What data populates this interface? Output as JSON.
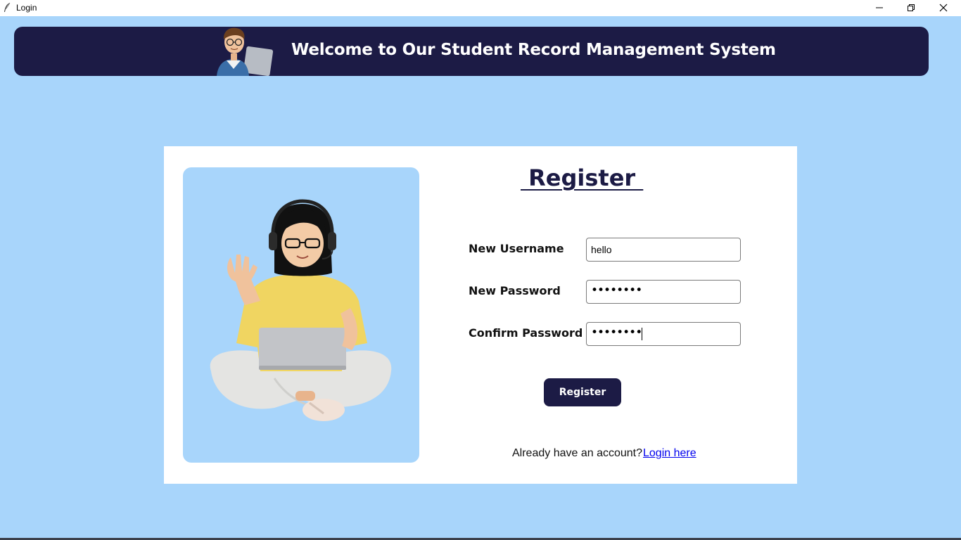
{
  "window": {
    "title": "Login",
    "icons": {
      "app": "feather-icon",
      "minimize": "minimize-icon",
      "maximize": "restore-icon",
      "close": "close-icon"
    }
  },
  "header": {
    "title": "Welcome to Our Student Record Management System",
    "avatar_icon": "student-avatar-icon"
  },
  "form": {
    "title": " Register ",
    "username_label": "New Username",
    "username_value": "hello",
    "password_label": "New Password",
    "password_value": "••••••••",
    "confirm_label": "Confirm Password",
    "confirm_value": "••••••••",
    "register_button": "Register",
    "already_text": "Already have an account?",
    "login_link": "Login here"
  },
  "colors": {
    "background": "#a8d5fb",
    "navy": "#1c1b45",
    "card": "#ffffff",
    "link": "#0000ee"
  }
}
